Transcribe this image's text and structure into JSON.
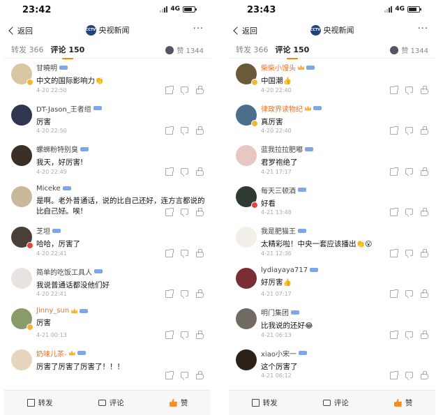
{
  "screens": [
    {
      "time": "23:42",
      "network": "4G",
      "back_label": "返回",
      "title": "央视新闻",
      "logo_text": "CCTV",
      "tab_repost": "转发 366",
      "tab_comment": "评论 150",
      "likes": "赞 1344",
      "comments": [
        {
          "name": "甘曉明",
          "text": "中文的国际影响力",
          "emoji": "👏",
          "date": "4-20 22:50",
          "vip": false,
          "avatar": "#d9c7a4",
          "badge": "#f4b63a"
        },
        {
          "name": "DT-Jason_王者组",
          "text": "厉害",
          "emoji": "",
          "date": "4-20 22:50",
          "vip": false,
          "avatar": "#2f3650",
          "badge": ""
        },
        {
          "name": "螺蛳粉特别臭",
          "text": "我天，好厉害!",
          "emoji": "",
          "date": "4-20 22:49",
          "vip": false,
          "avatar": "#3b3028",
          "badge": ""
        },
        {
          "name": "Miceke",
          "text": "是啊。老外普通话，说的比自己还好，连方言都说的比自己好。唉!",
          "emoji": "",
          "date": "4-20 22:42",
          "vip": false,
          "avatar": "#c9b99a",
          "badge": ""
        },
        {
          "name": "芝坦",
          "text": "哈哈，厉害了",
          "emoji": "",
          "date": "4-20 22:41",
          "vip": false,
          "avatar": "#4a4038",
          "badge": "#e0483e"
        },
        {
          "name": "简单的吃饭工具人",
          "text": "我说普通话都没他们好",
          "emoji": "",
          "date": "4-20 22:41",
          "vip": false,
          "avatar": "#e7e3e0",
          "badge": ""
        },
        {
          "name": "Jinny_sun",
          "text": "厉害",
          "emoji": "",
          "date": "4-21 00:13",
          "vip": true,
          "avatar": "#8a9b6a",
          "badge": "#f4b63a"
        },
        {
          "name": "奶味儿茶-",
          "text": "厉害了厉害了厉害了！！！",
          "emoji": "",
          "date": "",
          "vip": true,
          "avatar": "#e8d5c0",
          "badge": ""
        }
      ],
      "bottom": {
        "repost": "转发",
        "comment": "评论",
        "like": "赞"
      }
    },
    {
      "time": "23:43",
      "network": "4G",
      "back_label": "返回",
      "title": "央视新闻",
      "logo_text": "CCTV",
      "tab_repost": "转发 366",
      "tab_comment": "评论 150",
      "likes": "赞 1344",
      "comments": [
        {
          "name": "柴柴小馒头",
          "text": "中国潮",
          "emoji": "👍",
          "date": "4-20 22:40",
          "vip": true,
          "avatar": "#6b5a3a",
          "badge": "#f4b63a"
        },
        {
          "name": "律政界读物纪",
          "text": "真厉害",
          "emoji": "",
          "date": "4-20 22:40",
          "vip": true,
          "avatar": "#4c6e8a",
          "badge": "#f4b63a"
        },
        {
          "name": "蓝我拉拉肥嘟",
          "text": "君罗袍绝了",
          "emoji": "",
          "date": "4-21 17:17",
          "vip": false,
          "avatar": "#e8c6c4",
          "badge": ""
        },
        {
          "name": "每天三顿酒",
          "text": "好看",
          "emoji": "",
          "date": "4-21 13:48",
          "vip": false,
          "avatar": "#2f3a30",
          "badge": "#e0483e"
        },
        {
          "name": "我是肥猫王",
          "text": "太精彩啦！中央一套应该播出",
          "emoji": "👏😮",
          "date": "4-21 12:36",
          "vip": false,
          "avatar": "#f2efe8",
          "badge": ""
        },
        {
          "name": "lydiayaya717",
          "text": "好厉害",
          "emoji": "👍",
          "date": "4-21 07:17",
          "vip": false,
          "avatar": "#7a2e33",
          "badge": ""
        },
        {
          "name": "明门集团",
          "text": "比我说的还好",
          "emoji": "😂",
          "date": "4-21 06:13",
          "vip": false,
          "avatar": "#706a62",
          "badge": ""
        },
        {
          "name": "xiao小宋一",
          "text": "这个厉害了",
          "emoji": "",
          "date": "4-21 06:12",
          "vip": false,
          "avatar": "#2b2118",
          "badge": ""
        }
      ],
      "bottom": {
        "repost": "转发",
        "comment": "评论",
        "like": "赞"
      }
    }
  ]
}
